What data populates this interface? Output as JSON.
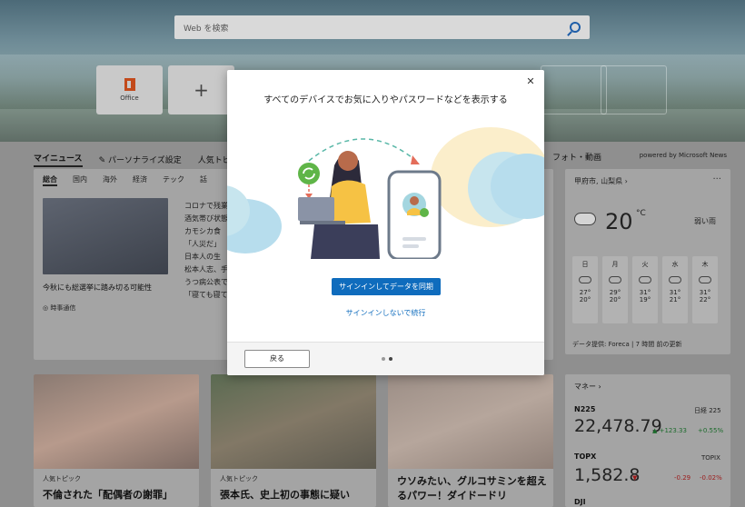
{
  "search": {
    "placeholder": "Web を検索"
  },
  "tiles": [
    {
      "label": "Office",
      "icon": "office-icon"
    },
    {
      "label": "",
      "icon": "plus-icon"
    }
  ],
  "nav": {
    "tabs": [
      "マイニュース",
      "パーソナライズ設定",
      "人気トピ"
    ],
    "right_label": "フォト・動画",
    "powered_by": "powered by Microsoft News"
  },
  "news": {
    "sub_tabs": [
      "総合",
      "国内",
      "海外",
      "経済",
      "テック",
      "話"
    ],
    "lead_caption": "今秋にも総選挙に踏み切る可能性",
    "lead_source": "時事通信",
    "headlines": [
      "コロナで残業",
      "酒気帯び状態",
      "カモシカ食",
      "「人災だ」",
      "日本人の生",
      "松本人志、手",
      "うつ病公表で",
      "「寝ても寝て"
    ]
  },
  "weather": {
    "location": "甲府市, 山梨県",
    "temp": "20",
    "unit": "°C",
    "desc": "弱い雨",
    "days": [
      {
        "name": "日",
        "hi": "27°",
        "lo": "20°"
      },
      {
        "name": "月",
        "hi": "29°",
        "lo": "20°"
      },
      {
        "name": "火",
        "hi": "31°",
        "lo": "19°"
      },
      {
        "name": "水",
        "hi": "31°",
        "lo": "21°"
      },
      {
        "name": "木",
        "hi": "31°",
        "lo": "22°"
      }
    ],
    "credit": "データ提供: Foreca | 7 時間 前の更新"
  },
  "money": {
    "title": "マネー",
    "rows": [
      {
        "name": "N225",
        "side_label": "日経 225",
        "value": "22,478.79",
        "change": "+123.33",
        "pct": "+0.55%",
        "trend": "up"
      },
      {
        "name": "TOPX",
        "side_label": "TOPIX",
        "value": "1,582.8",
        "change": "-0.29",
        "pct": "-0.02%",
        "trend": "down"
      },
      {
        "name": "DJI",
        "side_label": "",
        "value": "",
        "change": "",
        "pct": "",
        "trend": ""
      }
    ]
  },
  "cards": [
    {
      "tag": "人気トピック",
      "title": "不倫された「配偶者の謝罪」"
    },
    {
      "tag": "人気トピック",
      "title": "張本氏、史上初の事態に疑い"
    },
    {
      "tag": "",
      "title": "ウソみたい、グルコサミンを超えるパワー！ダイドードリ"
    }
  ],
  "modal": {
    "title": "すべてのデバイスでお気に入りやパスワードなどを表示する",
    "primary_button": "サインインしてデータを同期",
    "secondary_link": "サインインしないで続行",
    "back_button": "戻る",
    "page_count": 2,
    "current_page": 2
  },
  "colors": {
    "accent": "#0f6cbd",
    "up": "#1c6b2c",
    "down": "#9c1a1a"
  }
}
